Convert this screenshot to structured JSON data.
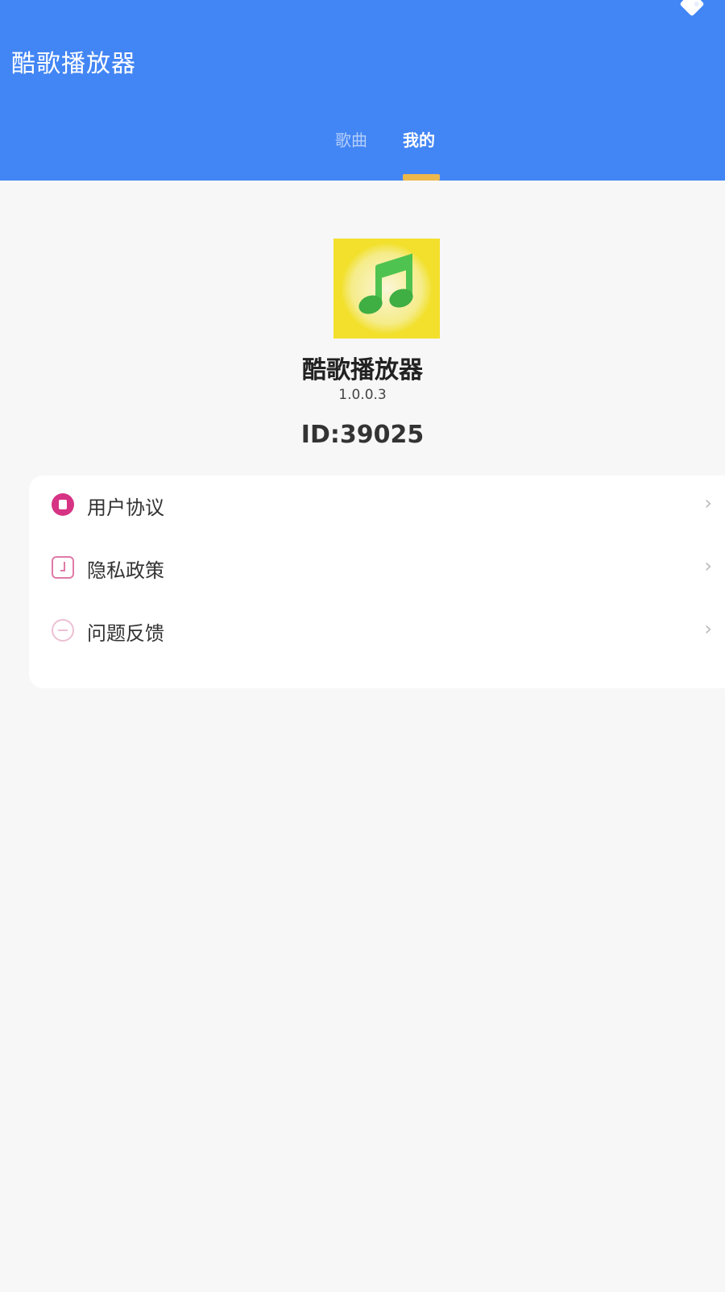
{
  "header": {
    "title": "酷歌播放器",
    "tabs": [
      {
        "label": "歌曲",
        "active": false
      },
      {
        "label": "我的",
        "active": true
      }
    ]
  },
  "profile": {
    "app_name": "酷歌播放器",
    "version": "1.0.0.3",
    "id_text": "ID:39025"
  },
  "menu": {
    "items": [
      {
        "label": "用户协议",
        "icon": "document-icon"
      },
      {
        "label": "隐私政策",
        "icon": "shield-icon"
      },
      {
        "label": "问题反馈",
        "icon": "feedback-icon"
      }
    ],
    "chevron": "›"
  },
  "colors": {
    "header_bg": "#4285f4",
    "tab_indicator": "#ecb84c",
    "page_bg": "#f7f7f7",
    "app_icon_bg": "#f2e02c",
    "music_note": "#4fc34f"
  }
}
